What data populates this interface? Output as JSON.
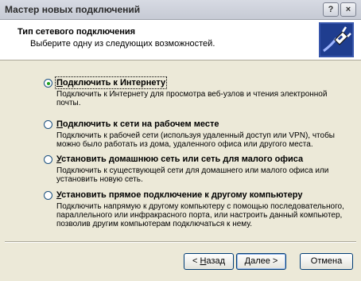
{
  "window": {
    "title": "Мастер новых подключений",
    "help_label": "?",
    "close_label": "×"
  },
  "header": {
    "title": "Тип сетевого подключения",
    "subtitle": "Выберите одну из следующих возможностей.",
    "icon": "network-connection-plug-icon"
  },
  "options": [
    {
      "label_key": "П",
      "label_rest": "одключить к Интернету",
      "checked": true,
      "description": "Подключить к Интернету для просмотра веб-узлов и чтения электронной почты."
    },
    {
      "label_key": "П",
      "label_rest": "одключить к сети на рабочем месте",
      "checked": false,
      "description": "Подключить к рабочей сети (используя удаленный доступ или VPN), чтобы можно было работать из дома, удаленного офиса или другого места."
    },
    {
      "label_key": "У",
      "label_rest": "становить домашнюю сеть или сеть для малого офиса",
      "checked": false,
      "description": "Подключить к существующей сети для домашнего или малого офиса или установить новую сеть."
    },
    {
      "label_key": "У",
      "label_rest": "становить прямое подключение к другому компьютеру",
      "checked": false,
      "description": "Подключить напрямую к другому компьютеру с помощью последовательного, параллельного или инфракрасного порта, или настроить данный компьютер, позволив другим компьютерам подключаться к нему."
    }
  ],
  "buttons": {
    "back_arrow": "< ",
    "back_key": "Н",
    "back_rest": "азад",
    "next_key": "Д",
    "next_rest": "алее >",
    "cancel": "Отмена"
  }
}
